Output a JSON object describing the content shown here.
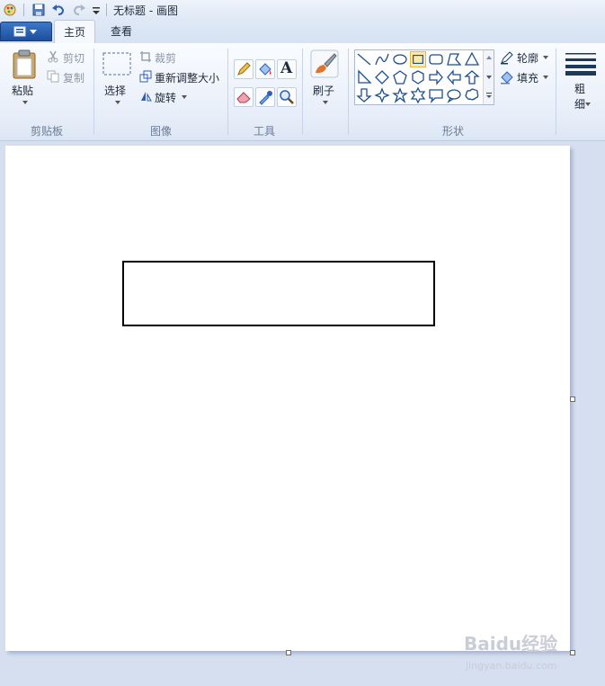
{
  "window": {
    "title": "无标题 - 画图"
  },
  "tabs": [
    {
      "label": "主页",
      "active": true
    },
    {
      "label": "查看",
      "active": false
    }
  ],
  "clipboard": {
    "paste": "粘贴",
    "cut": "剪切",
    "copy": "复制",
    "group": "剪贴板"
  },
  "image": {
    "select": "选择",
    "crop": "裁剪",
    "resize": "重新调整大小",
    "rotate": "旋转",
    "group": "图像"
  },
  "tools": {
    "group": "工具",
    "text_tool": "A"
  },
  "brush": {
    "label": "刷子"
  },
  "shapes": {
    "outline": "轮廓",
    "fill": "填充",
    "group": "形状"
  },
  "size": {
    "label": "粗细"
  },
  "watermark": {
    "brand": "Baidu经验",
    "url": "jingyan.baidu.com"
  },
  "colors": {
    "accent": "#1d4f9e",
    "ribbon": "#e7eef9",
    "selected": "#fde9a8"
  }
}
